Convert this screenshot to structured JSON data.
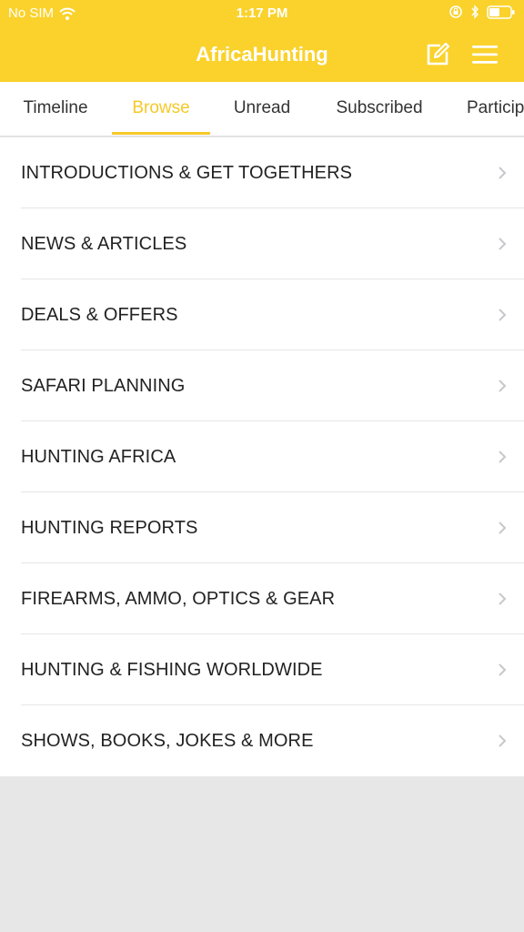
{
  "status_bar": {
    "carrier": "No SIM",
    "time": "1:17 PM",
    "icons": [
      "wifi-icon",
      "rotation-lock-icon",
      "bluetooth-icon",
      "battery-icon"
    ]
  },
  "header": {
    "title": "AfricaHunting",
    "background_color": "#fad22b",
    "compose_icon": "compose-icon",
    "menu_icon": "hamburger-menu-icon"
  },
  "tabs": [
    {
      "label": "Timeline"
    },
    {
      "label": "Browse",
      "active": true
    },
    {
      "label": "Unread"
    },
    {
      "label": "Subscribed"
    },
    {
      "label": "Participated"
    }
  ],
  "accent_color": "#f6c928",
  "forums": [
    {
      "label": "INTRODUCTIONS & GET TOGETHERS"
    },
    {
      "label": "NEWS & ARTICLES"
    },
    {
      "label": "DEALS & OFFERS"
    },
    {
      "label": "SAFARI PLANNING"
    },
    {
      "label": "HUNTING AFRICA"
    },
    {
      "label": "HUNTING REPORTS"
    },
    {
      "label": "FIREARMS, AMMO, OPTICS & GEAR"
    },
    {
      "label": "HUNTING & FISHING WORLDWIDE"
    },
    {
      "label": "SHOWS, BOOKS, JOKES & MORE"
    }
  ]
}
